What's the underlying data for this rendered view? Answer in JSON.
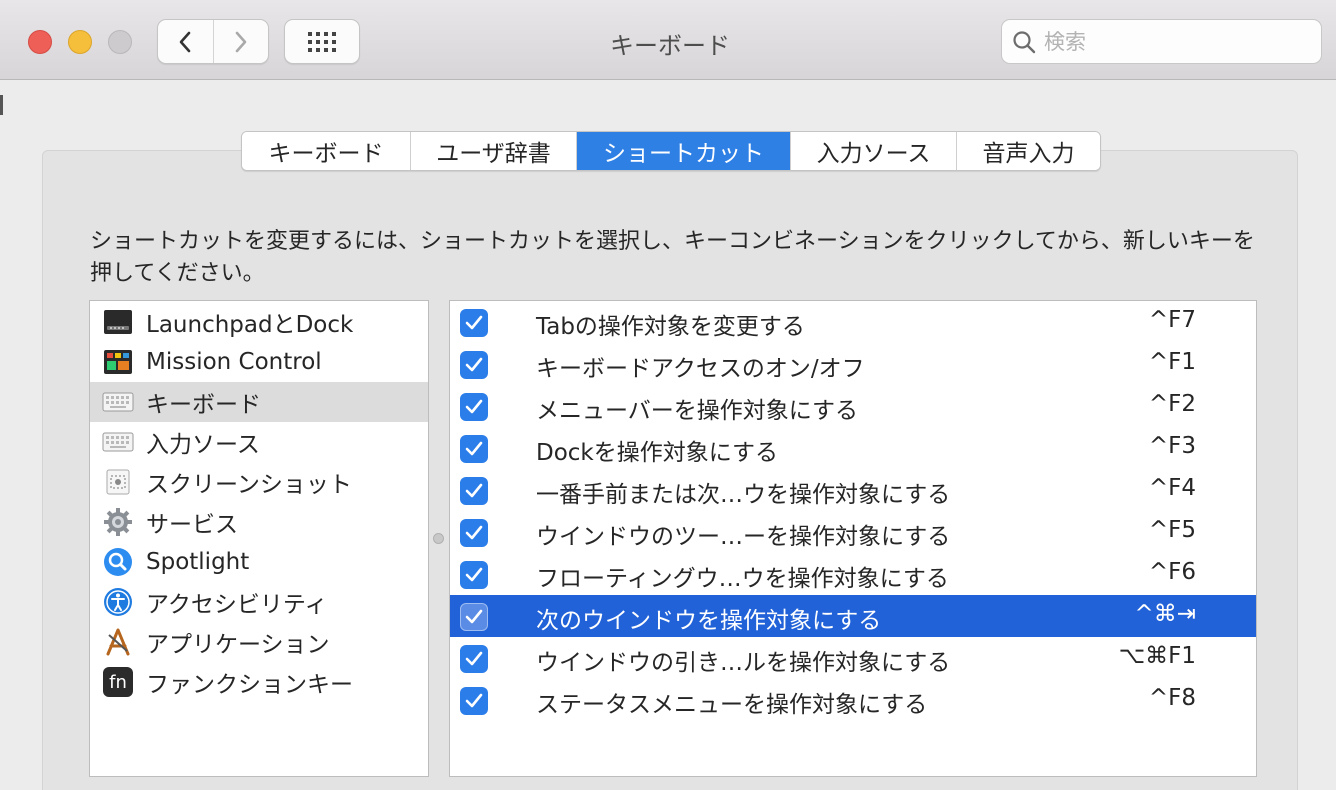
{
  "window": {
    "title": "キーボード",
    "search_placeholder": "検索",
    "colors": {
      "accent": "#2f80e5",
      "selection": "#2262d8",
      "close": "#ed5f57",
      "minimize": "#f5be3b"
    }
  },
  "tabs": [
    {
      "label": "キーボード",
      "active": false
    },
    {
      "label": "ユーザ辞書",
      "active": false
    },
    {
      "label": "ショートカット",
      "active": true
    },
    {
      "label": "入力ソース",
      "active": false
    },
    {
      "label": "音声入力",
      "active": false
    }
  ],
  "instructions": "ショートカットを変更するには、ショートカットを選択し、キーコンビネーションをクリックしてから、新しいキーを押してください。",
  "categories": [
    {
      "label": "LaunchpadとDock",
      "icon": "launchpad-dock-icon"
    },
    {
      "label": "Mission Control",
      "icon": "mission-control-icon"
    },
    {
      "label": "キーボード",
      "icon": "keyboard-icon",
      "selected": true
    },
    {
      "label": "入力ソース",
      "icon": "input-source-icon"
    },
    {
      "label": "スクリーンショット",
      "icon": "screenshot-icon"
    },
    {
      "label": "サービス",
      "icon": "gear-icon"
    },
    {
      "label": "Spotlight",
      "icon": "spotlight-icon"
    },
    {
      "label": "アクセシビリティ",
      "icon": "accessibility-icon"
    },
    {
      "label": "アプリケーション",
      "icon": "app-store-icon"
    },
    {
      "label": "ファンクションキー",
      "icon": "fn-key-icon"
    }
  ],
  "fn_icon_text": "fn",
  "shortcuts": [
    {
      "label": "Tabの操作対象を変更する",
      "key": "^F7",
      "checked": true
    },
    {
      "label": "キーボードアクセスのオン/オフ",
      "key": "^F1",
      "checked": true
    },
    {
      "label": "メニューバーを操作対象にする",
      "key": "^F2",
      "checked": true
    },
    {
      "label": "Dockを操作対象にする",
      "key": "^F3",
      "checked": true
    },
    {
      "label": "一番手前または次…ウを操作対象にする",
      "key": "^F4",
      "checked": true
    },
    {
      "label": "ウインドウのツー…ーを操作対象にする",
      "key": "^F5",
      "checked": true
    },
    {
      "label": "フローティングウ…ウを操作対象にする",
      "key": "^F6",
      "checked": true
    },
    {
      "label": "次のウインドウを操作対象にする",
      "key": "^⌘⇥",
      "checked": true,
      "selected": true
    },
    {
      "label": "ウインドウの引き…ルを操作対象にする",
      "key": "⌥⌘F1",
      "checked": true
    },
    {
      "label": "ステータスメニューを操作対象にする",
      "key": "^F8",
      "checked": true
    }
  ]
}
